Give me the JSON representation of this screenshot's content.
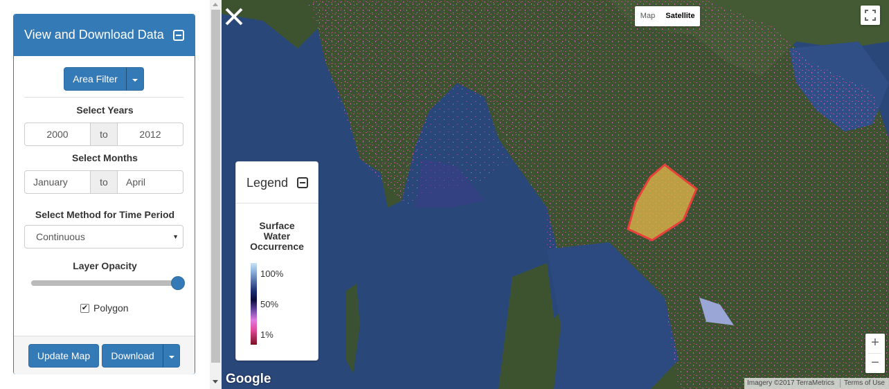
{
  "panel": {
    "title": "View and Download Data",
    "area_filter_label": "Area Filter",
    "select_years_label": "Select Years",
    "year_from": "2000",
    "year_to": "2012",
    "to_label": "to",
    "select_months_label": "Select Months",
    "month_from": "January",
    "month_to": "April",
    "method_label": "Select Method for Time Period",
    "method_value": "Continuous",
    "opacity_label": "Layer Opacity",
    "opacity_value": 1.0,
    "polygon_label": "Polygon",
    "polygon_checked": true,
    "update_map_label": "Update Map",
    "download_label": "Download"
  },
  "map": {
    "map_type_map": "Map",
    "map_type_satellite": "Satellite",
    "active_map_type": "Satellite",
    "legend": {
      "title": "Legend",
      "subtitle_line1": "Surface",
      "subtitle_line2": "Water",
      "subtitle_line3": "Occurrence",
      "ticks": [
        "100%",
        "50%",
        "1%"
      ]
    },
    "zoom_in": "+",
    "zoom_out": "−",
    "logo": "Google",
    "imagery_credit": "Imagery ©2017 TerraMetrics",
    "terms": "Terms of Use"
  },
  "colors": {
    "primary": "#337ab7",
    "polygon_fill": "#e8b84a",
    "polygon_stroke": "#e8403a"
  }
}
